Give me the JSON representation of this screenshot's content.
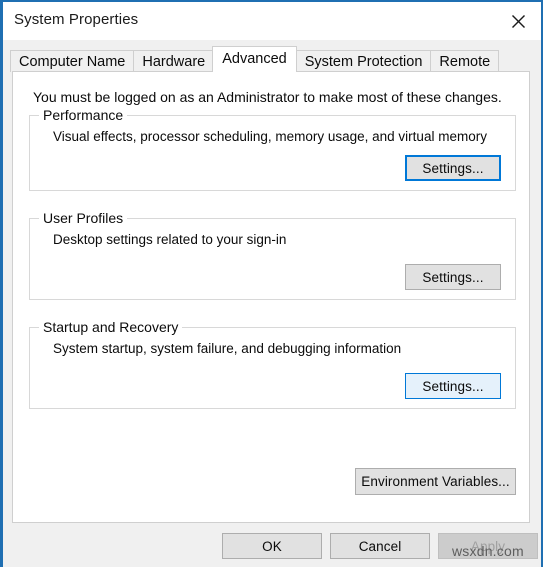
{
  "window": {
    "title": "System Properties",
    "close_icon": "close-icon",
    "accent_color": "#1f6fb2"
  },
  "tabs": [
    {
      "label": "Computer Name",
      "selected": false
    },
    {
      "label": "Hardware",
      "selected": false
    },
    {
      "label": "Advanced",
      "selected": true
    },
    {
      "label": "System Protection",
      "selected": false
    },
    {
      "label": "Remote",
      "selected": false
    }
  ],
  "panel": {
    "admin_note": "You must be logged on as an Administrator to make most of these changes."
  },
  "groups": [
    {
      "legend": "Performance",
      "description": "Visual effects, processor scheduling, memory usage, and virtual memory",
      "button_label": "Settings...",
      "button_state": "focused"
    },
    {
      "legend": "User Profiles",
      "description": "Desktop settings related to your sign-in",
      "button_label": "Settings...",
      "button_state": "normal"
    },
    {
      "legend": "Startup and Recovery",
      "description": "System startup, system failure, and debugging information",
      "button_label": "Settings...",
      "button_state": "hovered"
    }
  ],
  "environment": {
    "button_label": "Environment Variables..."
  },
  "footer": {
    "ok_label": "OK",
    "cancel_label": "Cancel",
    "apply_label": "Apply",
    "apply_disabled": true
  },
  "watermark": {
    "text": "wsxdn.com"
  },
  "colors": {
    "focus_blue": "#0078d7",
    "hover_fill": "#e5f1fb",
    "button_face": "#e1e1e1",
    "dialog_face": "#f0f0f0",
    "disabled_text": "#a0a0a0"
  }
}
